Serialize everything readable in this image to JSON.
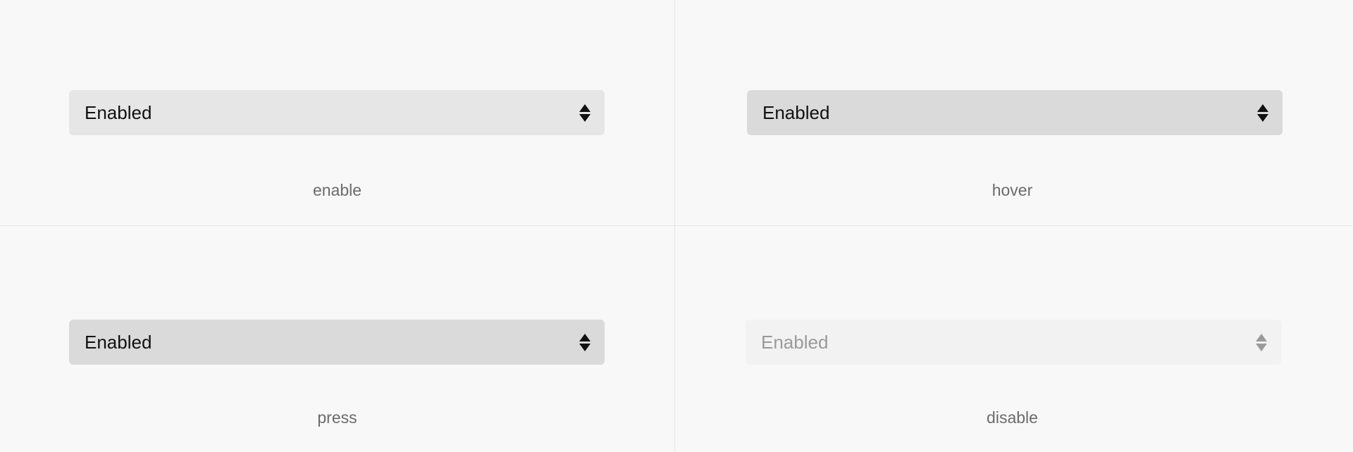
{
  "states": [
    {
      "select_value": "Enabled",
      "caption": "enable"
    },
    {
      "select_value": "Enabled",
      "caption": "hover"
    },
    {
      "select_value": "Enabled",
      "caption": "press"
    },
    {
      "select_value": "Enabled",
      "caption": "disable"
    }
  ],
  "colors": {
    "page_background": "#f8f8f8",
    "divider": "#e4e4e4",
    "enable_fill": "#e6e6e6",
    "hover_fill": "#dadada",
    "press_fill": "#dadada",
    "disable_fill": "#f2f2f2",
    "text": "#111111",
    "disabled_text": "#9a9a9a",
    "caption_text": "#6b6b6b"
  },
  "icons": {
    "select_indicator": "up-down-arrows-icon"
  }
}
